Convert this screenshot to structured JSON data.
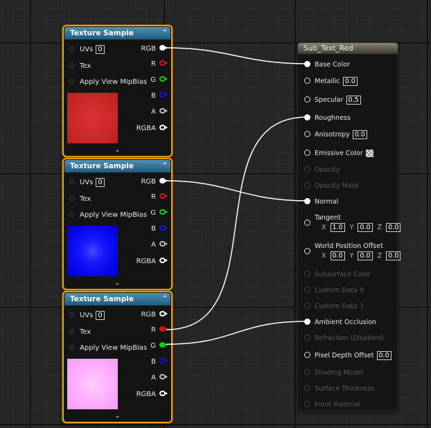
{
  "texture_nodes": [
    {
      "title": "Texture Sample",
      "inputs": [
        {
          "label": "UVs",
          "value": "0"
        },
        {
          "label": "Tex",
          "value": ""
        },
        {
          "label": "Apply View MipBias",
          "value": ""
        }
      ],
      "outputs": [
        "RGB",
        "R",
        "G",
        "B",
        "A",
        "RGBA"
      ],
      "preview_color": "#d42b2b"
    },
    {
      "title": "Texture Sample",
      "inputs": [
        {
          "label": "UVs",
          "value": "0"
        },
        {
          "label": "Tex",
          "value": ""
        },
        {
          "label": "Apply View MipBias",
          "value": ""
        }
      ],
      "outputs": [
        "RGB",
        "R",
        "G",
        "B",
        "A",
        "RGBA"
      ],
      "preview_color": "#1414ff"
    },
    {
      "title": "Texture Sample",
      "inputs": [
        {
          "label": "UVs",
          "value": "0"
        },
        {
          "label": "Tex",
          "value": ""
        },
        {
          "label": "Apply View MipBias",
          "value": ""
        }
      ],
      "outputs": [
        "RGB",
        "R",
        "G",
        "B",
        "A",
        "RGBA"
      ],
      "preview_color": "#ffb0ff"
    }
  ],
  "pin_colors": {
    "RGB": "#ffffff",
    "R": "#e01010",
    "G": "#10d010",
    "B": "#1010e0",
    "A": "#bbbbbb",
    "RGBA": "#ffffff"
  },
  "material": {
    "title": "Sub_Text_Red",
    "pins": [
      {
        "label": "Base Color",
        "state": "connected",
        "value": ""
      },
      {
        "label": "Metallic",
        "state": "open",
        "value": "0.0"
      },
      {
        "label": "Specular",
        "state": "open",
        "value": "0.5"
      },
      {
        "label": "Roughness",
        "state": "connected",
        "value": ""
      },
      {
        "label": "Anisotropy",
        "state": "open",
        "value": "0.0"
      },
      {
        "label": "Emissive Color",
        "state": "open",
        "value": ""
      },
      {
        "label": "Opacity",
        "state": "disabled",
        "value": ""
      },
      {
        "label": "Opacity Mask",
        "state": "disabled",
        "value": ""
      },
      {
        "label": "Normal",
        "state": "connected",
        "value": ""
      },
      {
        "label": "Tangent",
        "state": "open",
        "value": "",
        "vector": [
          "1.0",
          "0.0",
          "0.0"
        ]
      },
      {
        "label": "World Position Offset",
        "state": "open",
        "value": "",
        "vector": [
          "0.0",
          "0.0",
          "0.0"
        ]
      },
      {
        "label": "Subsurface Color",
        "state": "disabled",
        "value": ""
      },
      {
        "label": "Custom Data 0",
        "state": "disabled",
        "value": ""
      },
      {
        "label": "Custom Data 1",
        "state": "disabled",
        "value": ""
      },
      {
        "label": "Ambient Occlusion",
        "state": "connected",
        "value": ""
      },
      {
        "label": "Refraction (Disabled)",
        "state": "disabled",
        "value": ""
      },
      {
        "label": "Pixel Depth Offset",
        "state": "open",
        "value": "0.0"
      },
      {
        "label": "Shading Model",
        "state": "disabled",
        "value": ""
      },
      {
        "label": "Surface Thickness",
        "state": "disabled",
        "value": ""
      },
      {
        "label": "Front Material",
        "state": "disabled",
        "value": ""
      }
    ],
    "vector_axes": [
      "X",
      "Y",
      "Z"
    ]
  },
  "connections": [
    {
      "from_node": 0,
      "from_pin": "RGB",
      "to_pin": "Base Color"
    },
    {
      "from_node": 1,
      "from_pin": "RGB",
      "to_pin": "Normal"
    },
    {
      "from_node": 2,
      "from_pin": "R",
      "to_pin": "Roughness"
    },
    {
      "from_node": 2,
      "from_pin": "G",
      "to_pin": "Ambient Occlusion"
    }
  ]
}
